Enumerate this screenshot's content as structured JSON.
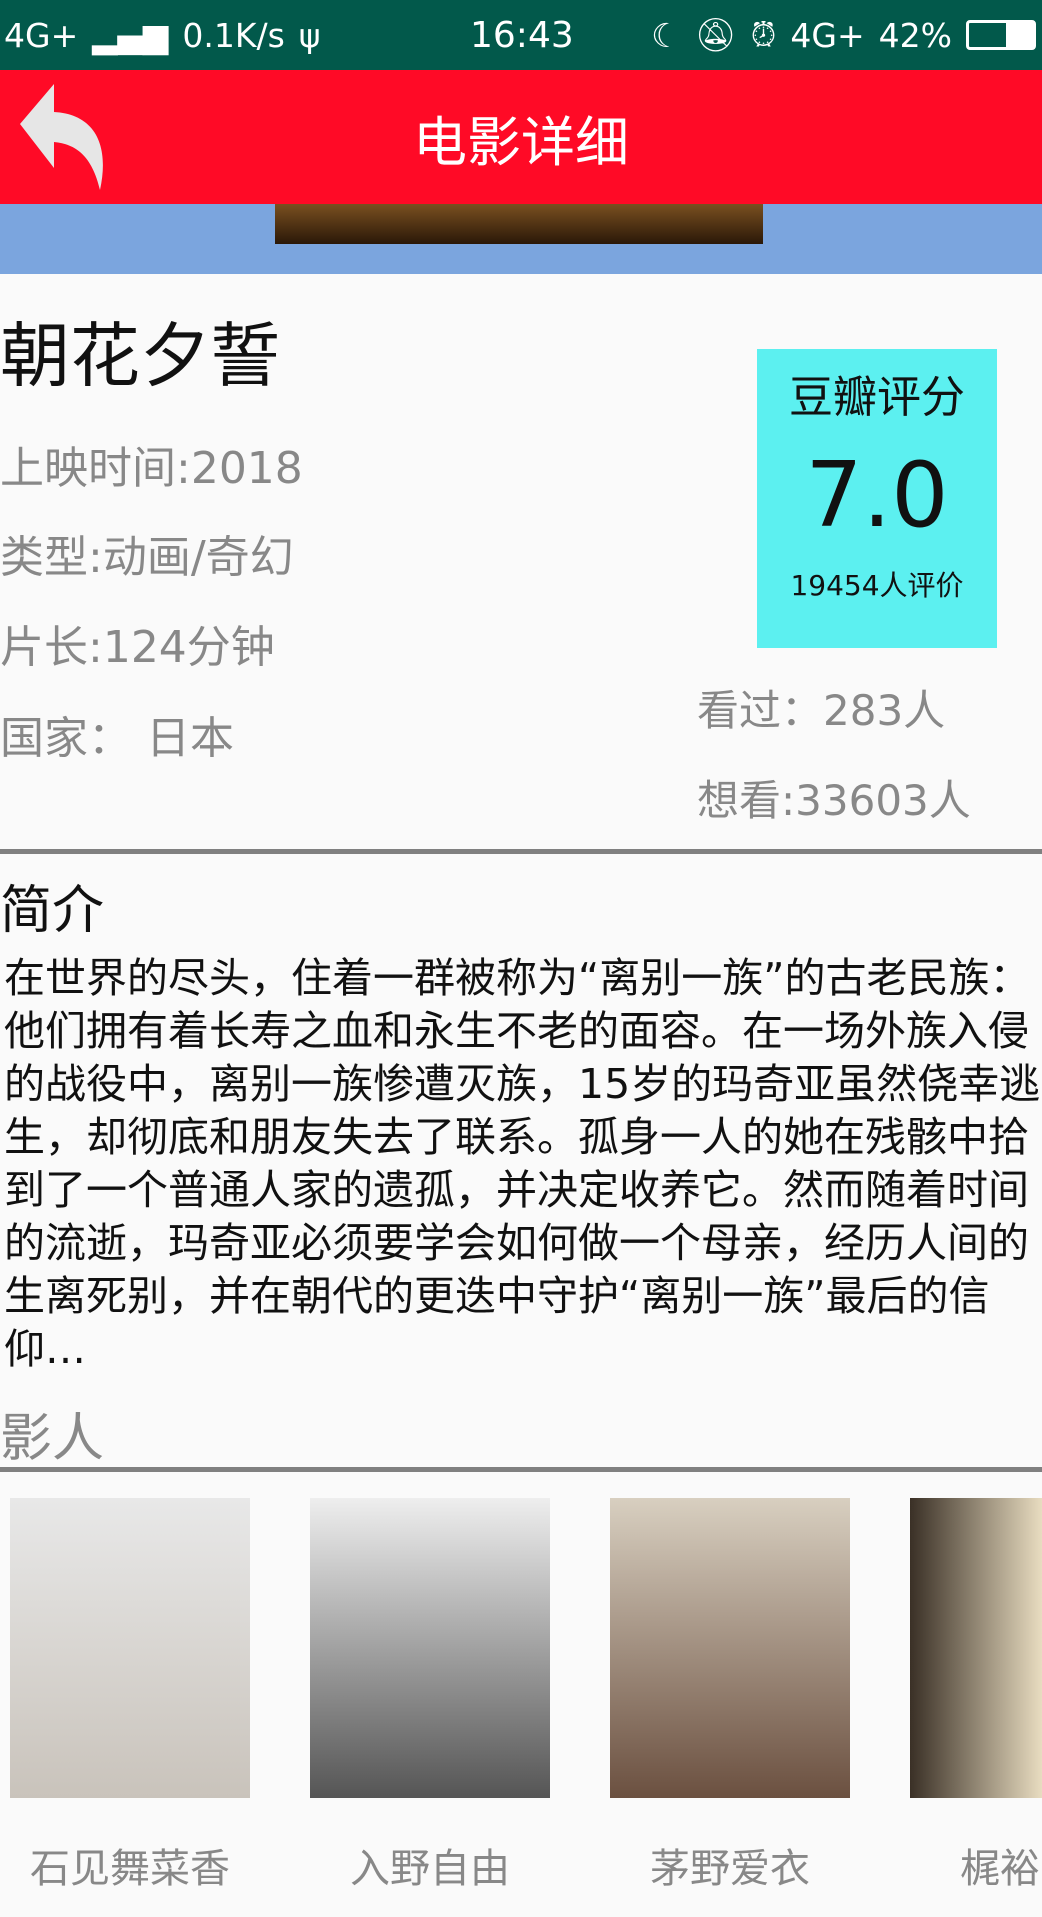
{
  "status_bar": {
    "network": "4G+",
    "speed": "0.1K/s",
    "time": "16:43",
    "network2": "4G+",
    "battery": "42%"
  },
  "header": {
    "title": "电影详细",
    "back_icon": "back-arrow-icon"
  },
  "movie": {
    "title": "朝花夕誓",
    "release": "上映时间:2018",
    "genre": "类型:动画/奇幻",
    "length": "片长:124分钟",
    "country": "国家： 日本",
    "watched": "看过：283人",
    "want": "想看:33603人"
  },
  "rating": {
    "label": "豆瓣评分",
    "score": "7.0",
    "count": "19454人评价",
    "bg_color": "#5cf0f0"
  },
  "synopsis": {
    "heading": "简介",
    "text": "在世界的尽头，住着一群被称为“离别一族”的古老民族：他们拥有着长寿之血和永生不老的面容。在一场外族入侵的战役中，离别一族惨遭灭族，15岁的玛奇亚虽然侥幸逃生，却彻底和朋友失去了联系。孤身一人的她在残骸中拾到了一个普通人家的遗孤，并决定收养它。然而随着时间的流逝，玛奇亚必须要学会如何做一个母亲，经历人间的生离死别，并在朝代的更迭中守护“离别一族”最后的信仰…"
  },
  "cast": {
    "heading": "影人",
    "members": [
      {
        "name": "石见舞菜香"
      },
      {
        "name": "入野自由"
      },
      {
        "name": "茅野爱衣"
      },
      {
        "name": "梶裕"
      }
    ]
  },
  "colors": {
    "status": "#02594b",
    "header": "#ff0a26",
    "banner": "#7ba5de"
  }
}
